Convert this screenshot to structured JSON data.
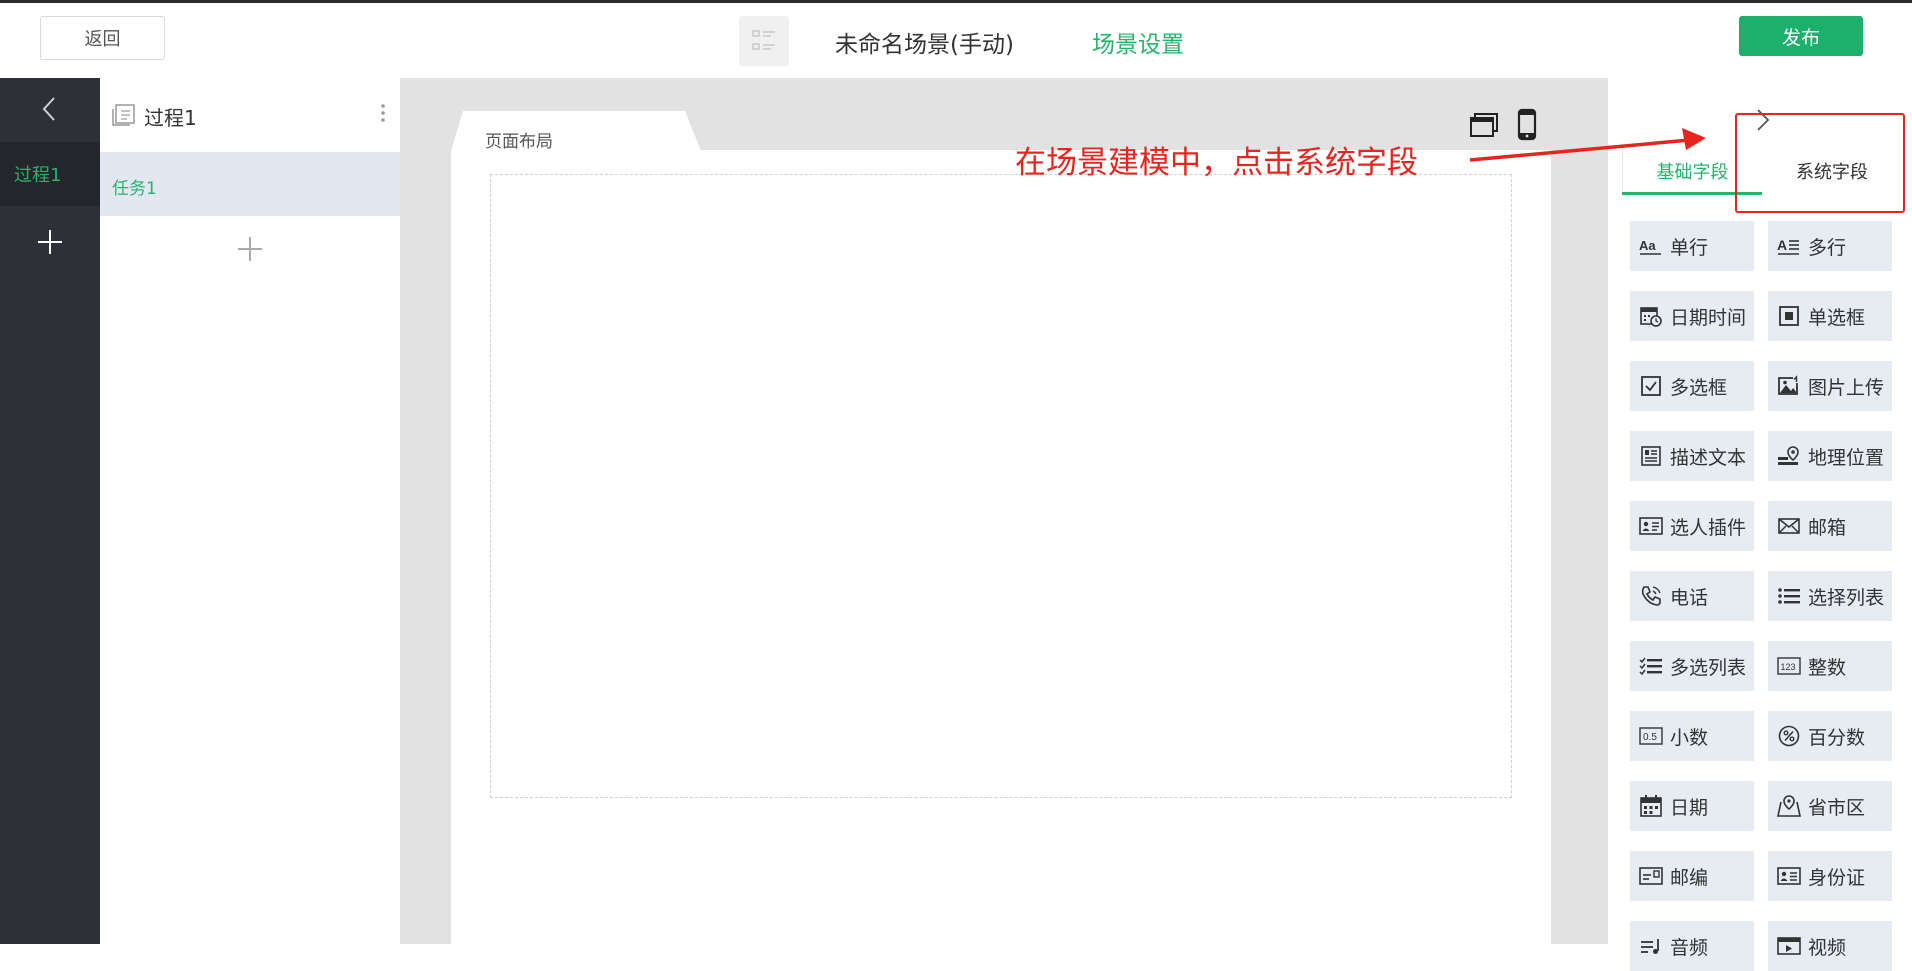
{
  "header": {
    "back_label": "返回",
    "scene_title": "未命名场景(手动)",
    "scene_settings_label": "场景设置",
    "publish_label": "发布"
  },
  "sidebar": {
    "process_tab_label": "过程1"
  },
  "process_panel": {
    "title": "过程1",
    "tasks": [
      {
        "label": "任务1"
      }
    ]
  },
  "canvas": {
    "page_tab_label": "页面布局"
  },
  "annotation": {
    "text": "在场景建模中，点击系统字段",
    "color": "#e8241e"
  },
  "right_panel": {
    "tabs": [
      {
        "label": "基础字段",
        "active": true
      },
      {
        "label": "系统字段",
        "active": false
      }
    ],
    "fields": [
      {
        "label": "单行",
        "icon": "text-aa-icon"
      },
      {
        "label": "多行",
        "icon": "multiline-text-icon"
      },
      {
        "label": "日期时间",
        "icon": "calendar-clock-icon"
      },
      {
        "label": "单选框",
        "icon": "radio-square-icon"
      },
      {
        "label": "多选框",
        "icon": "checkbox-icon"
      },
      {
        "label": "图片上传",
        "icon": "image-upload-icon"
      },
      {
        "label": "描述文本",
        "icon": "description-text-icon"
      },
      {
        "label": "地理位置",
        "icon": "location-icon"
      },
      {
        "label": "选人插件",
        "icon": "contact-card-icon"
      },
      {
        "label": "邮箱",
        "icon": "mail-icon"
      },
      {
        "label": "电话",
        "icon": "phone-icon"
      },
      {
        "label": "选择列表",
        "icon": "list-icon"
      },
      {
        "label": "多选列表",
        "icon": "checklist-icon"
      },
      {
        "label": "整数",
        "icon": "integer-123-icon"
      },
      {
        "label": "小数",
        "icon": "decimal-icon"
      },
      {
        "label": "百分数",
        "icon": "percent-icon"
      },
      {
        "label": "日期",
        "icon": "calendar-icon"
      },
      {
        "label": "省市区",
        "icon": "map-region-icon"
      },
      {
        "label": "邮编",
        "icon": "postcode-icon"
      },
      {
        "label": "身份证",
        "icon": "id-card-icon"
      },
      {
        "label": "音频",
        "icon": "audio-icon"
      },
      {
        "label": "视频",
        "icon": "video-icon"
      }
    ]
  },
  "colors": {
    "accent": "#27b36b",
    "publish": "#1bb06c",
    "sidebar_bg": "#2e3038",
    "canvas_bg": "#e2e2e2",
    "field_bg": "#e7ebf2"
  }
}
